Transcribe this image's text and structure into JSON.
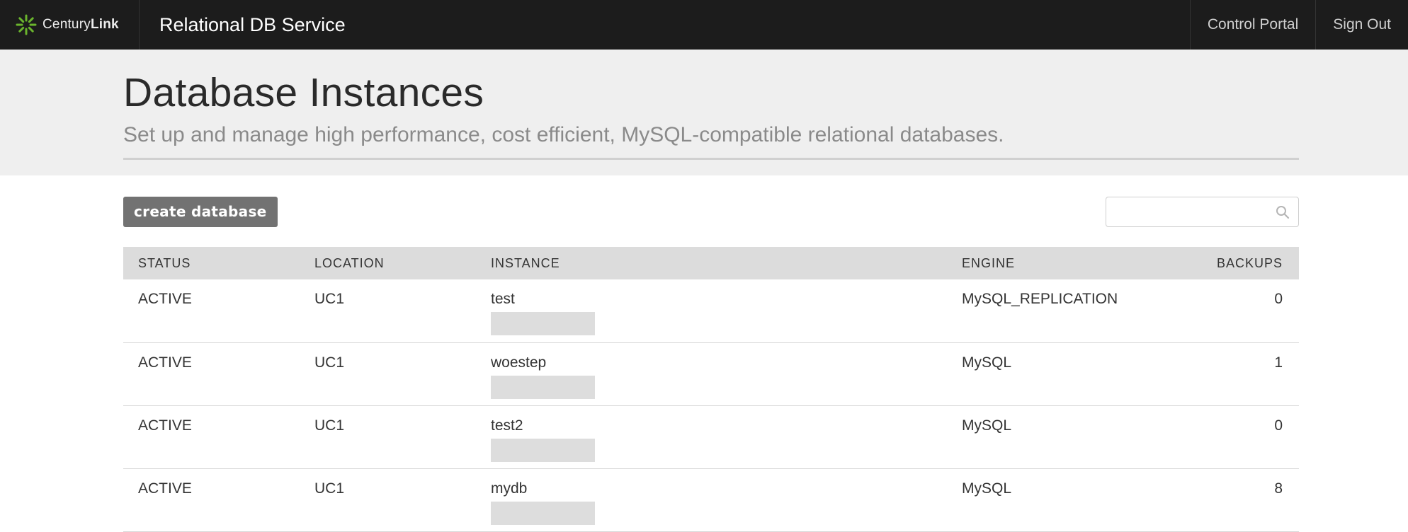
{
  "header": {
    "brand_name": "Century",
    "brand_bold": "Link",
    "app_title": "Relational DB Service",
    "nav": [
      {
        "label": "Control Portal"
      },
      {
        "label": "Sign Out"
      }
    ]
  },
  "hero": {
    "title": "Database Instances",
    "subtitle": "Set up and manage high performance, cost efficient, MySQL-compatible relational databases."
  },
  "toolbar": {
    "create_label": "create database",
    "search_placeholder": ""
  },
  "table": {
    "columns": {
      "status": "STATUS",
      "location": "LOCATION",
      "instance": "INSTANCE",
      "engine": "ENGINE",
      "backups": "BACKUPS"
    },
    "rows": [
      {
        "status": "ACTIVE",
        "location": "UC1",
        "instance": "test",
        "engine": "MySQL_REPLICATION",
        "backups": "0"
      },
      {
        "status": "ACTIVE",
        "location": "UC1",
        "instance": "woestep",
        "engine": "MySQL",
        "backups": "1"
      },
      {
        "status": "ACTIVE",
        "location": "UC1",
        "instance": "test2",
        "engine": "MySQL",
        "backups": "0"
      },
      {
        "status": "ACTIVE",
        "location": "UC1",
        "instance": "mydb",
        "engine": "MySQL",
        "backups": "8"
      }
    ]
  },
  "colors": {
    "topbar": "#1c1c1c",
    "hero_bg": "#efefef",
    "button": "#727272",
    "brand_accent": "#6ab42d"
  }
}
